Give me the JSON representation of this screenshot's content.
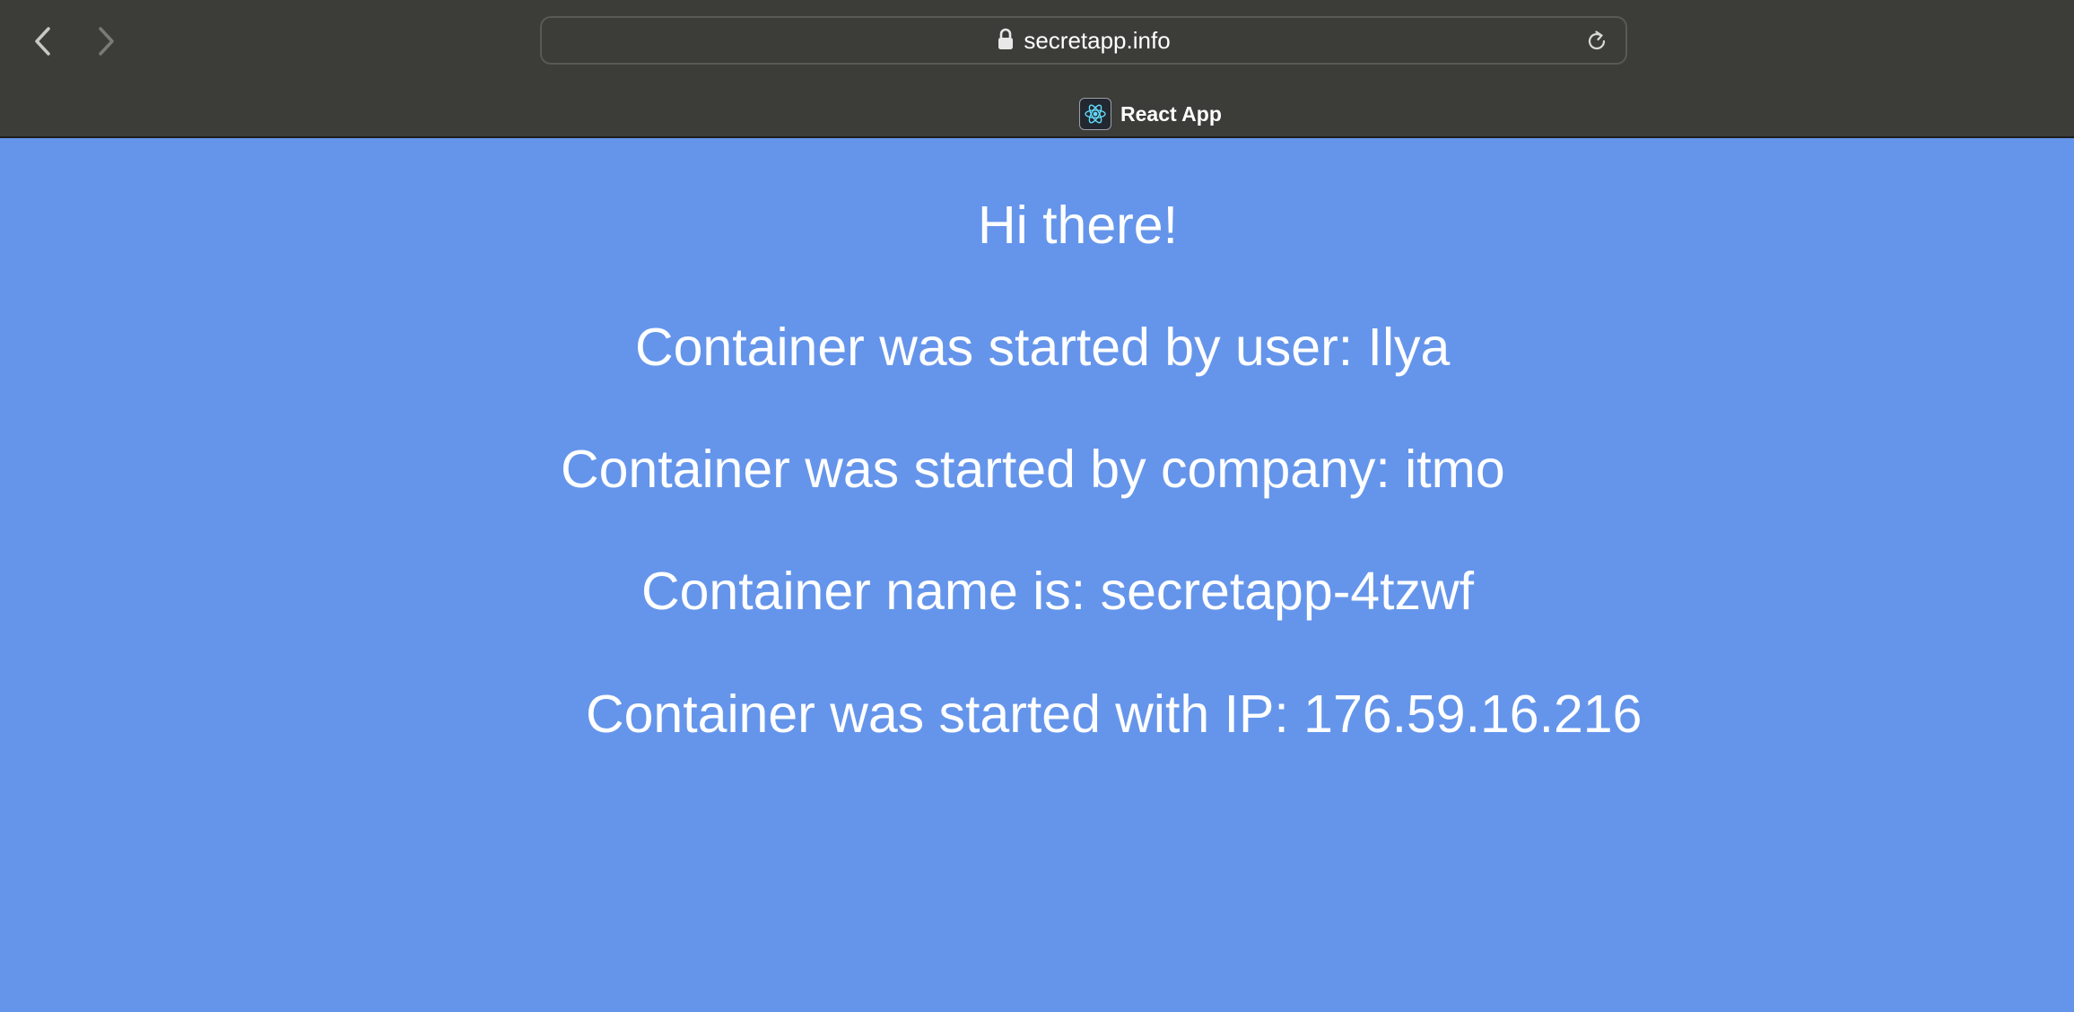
{
  "browser": {
    "url": "secretapp.info",
    "tab_title": "React App",
    "icons": {
      "back": "chevron-left-icon",
      "forward": "chevron-right-icon",
      "lock": "lock-icon",
      "reload": "reload-icon",
      "favicon": "react-logo-icon"
    }
  },
  "page": {
    "background_color": "#6595eb",
    "greeting": "Hi there!",
    "user_line": "Container was started by user: Ilya",
    "company_line": "Container was started by company: itmo",
    "name_line": "Container name is: secretapp-4tzwf",
    "ip_line": "Container was started with IP: 176.59.16.216"
  }
}
